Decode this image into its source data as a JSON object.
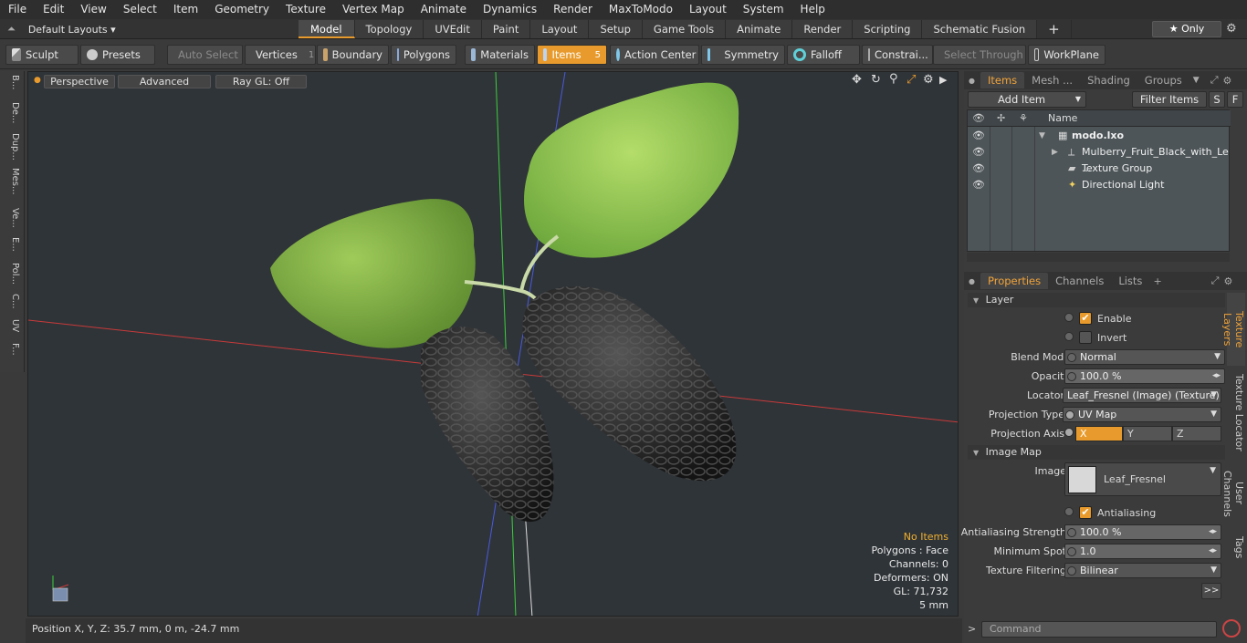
{
  "menu": [
    "File",
    "Edit",
    "View",
    "Select",
    "Item",
    "Geometry",
    "Texture",
    "Vertex Map",
    "Animate",
    "Dynamics",
    "Render",
    "MaxToModo",
    "Layout",
    "System",
    "Help"
  ],
  "layouts": {
    "label": "Default Layouts ▾"
  },
  "mode_tabs": [
    {
      "label": "Model",
      "active": true
    },
    {
      "label": "Topology"
    },
    {
      "label": "UVEdit"
    },
    {
      "label": "Paint"
    },
    {
      "label": "Layout"
    },
    {
      "label": "Setup"
    },
    {
      "label": "Game Tools"
    },
    {
      "label": "Animate"
    },
    {
      "label": "Render"
    },
    {
      "label": "Scripting"
    },
    {
      "label": "Schematic Fusion"
    }
  ],
  "plus_label": "+",
  "only": {
    "label": "★  Only"
  },
  "toolbar": {
    "sculpt": "Sculpt",
    "presets": "Presets",
    "auto_select": "Auto Select",
    "vertices": "Vertices",
    "vertices_count": "1",
    "boundary": "Boundary",
    "polygons": "Polygons",
    "materials": "Materials",
    "items": "Items",
    "items_count": "5",
    "action_center": "Action Center",
    "symmetry": "Symmetry",
    "falloff": "Falloff",
    "constraints": "Constrai...",
    "select_through": "Select Through",
    "workplane": "WorkPlane"
  },
  "left_tabs": [
    "B...",
    "De...",
    "Dup...",
    "Mes...",
    "Ve...",
    "E...",
    "Pol...",
    "C...",
    "UV",
    "F..."
  ],
  "viewport": {
    "perspective": "Perspective",
    "advanced": "Advanced",
    "raygl": "Ray GL: Off",
    "stats": {
      "no_items": "No Items",
      "polygons": "Polygons : Face",
      "channels": "Channels: 0",
      "deformers": "Deformers: ON",
      "gl": "GL: 71,732",
      "unit": "5 mm"
    }
  },
  "status": {
    "position": "Position X, Y, Z:   35.7 mm, 0 m, -24.7 mm"
  },
  "panel_top": {
    "tabs": [
      {
        "label": "Items",
        "on": true
      },
      {
        "label": "Mesh ..."
      },
      {
        "label": "Shading"
      },
      {
        "label": "Groups"
      }
    ],
    "add_item": "Add Item",
    "filter_items": "Filter Items",
    "s": "S",
    "f": "F",
    "name_col": "Name",
    "items": [
      {
        "label": "modo.lxo"
      },
      {
        "label": "Mulberry_Fruit_Black_with_Le ..."
      },
      {
        "label": "Texture Group"
      },
      {
        "label": "Directional Light"
      }
    ]
  },
  "panel_props": {
    "tabs": [
      {
        "label": "Properties",
        "on": true
      },
      {
        "label": "Channels"
      },
      {
        "label": "Lists"
      }
    ],
    "layer": "Layer",
    "enable": "Enable",
    "invert": "Invert",
    "blend_mode_label": "Blend Mode",
    "blend_mode": "Normal",
    "opacity_label": "Opacity",
    "opacity": "100.0 %",
    "locator_label": "Locator",
    "locator": "Leaf_Fresnel (Image) (Texture)",
    "proj_type_label": "Projection Type",
    "proj_type": "UV Map",
    "proj_axis_label": "Projection Axis",
    "axis_x": "X",
    "axis_y": "Y",
    "axis_z": "Z",
    "image_map": "Image Map",
    "image_label": "Image",
    "image": "Leaf_Fresnel",
    "antialiasing": "Antialiasing",
    "aa_strength_label": "Antialiasing Strength",
    "aa_strength": "100.0 %",
    "min_spot_label": "Minimum Spot",
    "min_spot": "1.0",
    "tex_filter_label": "Texture Filtering",
    "tex_filter": "Bilinear",
    "more": ">>",
    "side_tabs": [
      "Texture Layers",
      "Texture Locator",
      "User Channels",
      "Tags"
    ]
  },
  "command": {
    "placeholder": "Command"
  }
}
